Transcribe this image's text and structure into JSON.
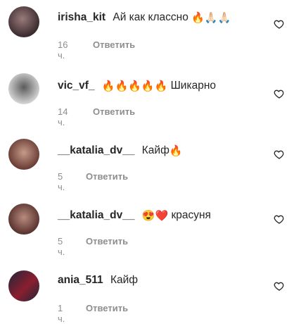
{
  "comments": [
    {
      "username": "irisha_kit",
      "text": "Ай как классно",
      "emojis": "🔥🙏🏻🙏🏻",
      "time": "16 ч.",
      "reply": "Ответить",
      "avatar_colors": [
        "#3b2b2e",
        "#9a7b7c"
      ]
    },
    {
      "username": "vic_vf_",
      "text": "Шикарно",
      "emojis": "🔥🔥🔥🔥🔥",
      "time": "14 ч.",
      "reply": "Ответить",
      "avatar_colors": [
        "#d9d9d9",
        "#5b5b5b"
      ]
    },
    {
      "username": "__katalia_dv__",
      "text": "Кайф",
      "emojis": "🔥",
      "time": "5 ч.",
      "reply": "Ответить",
      "avatar_colors": [
        "#6b3d35",
        "#c69b8a"
      ]
    },
    {
      "username": "__katalia_dv__",
      "text": "красуня",
      "emojis": "😍❤️",
      "time": "5 ч.",
      "reply": "Ответить",
      "avatar_colors": [
        "#5a342f",
        "#b98c7e"
      ]
    },
    {
      "username": "ania_511",
      "text": "Кайф",
      "emojis": "",
      "time": "1 ч.",
      "reply": "Ответить",
      "avatar_colors": [
        "#20243a",
        "#8a1f2f"
      ]
    }
  ]
}
